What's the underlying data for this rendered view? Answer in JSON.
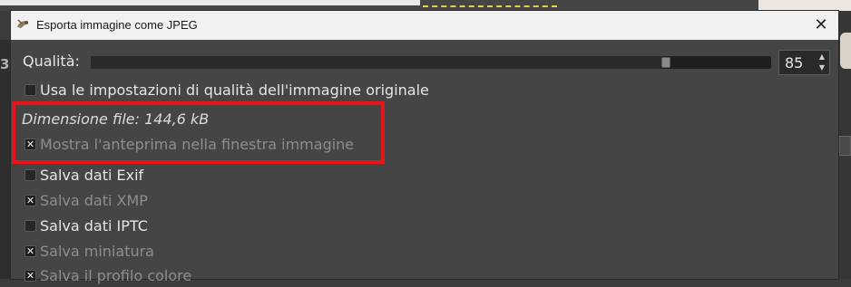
{
  "dialog": {
    "title": "Esporta immagine come JPEG",
    "close_icon": "close-icon"
  },
  "background": {
    "left_panel_number": "3"
  },
  "quality": {
    "label": "Qualità:",
    "value": "85",
    "slider_fraction": 0.85
  },
  "options": {
    "use_original_quality": {
      "label": "Usa le impostazioni di qualità dell'immagine originale",
      "checked": false,
      "enabled": true
    },
    "file_size": "Dimensione file: 144,6 kB",
    "show_preview": {
      "label": "Mostra l'anteprima nella finestra immagine",
      "checked": true,
      "enabled": false
    },
    "save_exif": {
      "label": "Salva dati Exif",
      "checked": false,
      "enabled": true
    },
    "save_xmp": {
      "label": "Salva dati XMP",
      "checked": true,
      "enabled": false
    },
    "save_iptc": {
      "label": "Salva dati IPTC",
      "checked": false,
      "enabled": true
    },
    "save_thumbnail": {
      "label": "Salva miniatura",
      "checked": true,
      "enabled": false
    },
    "save_color_profile": {
      "label": "Salva il profilo colore",
      "checked": true,
      "enabled": false
    }
  },
  "annotation": {
    "color": "#e8141a"
  }
}
